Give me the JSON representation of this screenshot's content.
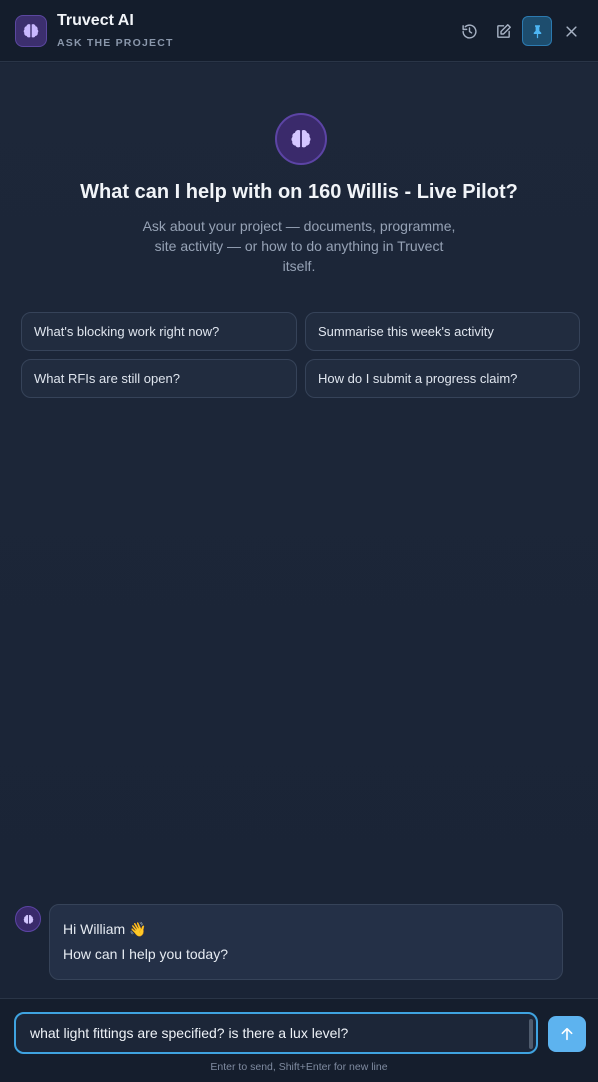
{
  "header": {
    "title": "Truvect AI",
    "subtitle": "ASK THE PROJECT",
    "icons": [
      "brain-icon",
      "history-icon",
      "edit-icon",
      "pin-icon",
      "close-icon"
    ]
  },
  "hero": {
    "title": "What can I help with on 160 Willis - Live Pilot?",
    "description": "Ask about your project — documents, programme, site activity — or how to do anything in Truvect itself."
  },
  "suggestions": [
    "What's blocking work right now?",
    "Summarise this week's activity",
    "What RFIs are still open?",
    "How do I submit a progress claim?"
  ],
  "message": {
    "greeting": "Hi William 👋",
    "text": "How can I help you today?"
  },
  "composer": {
    "value": "what light fittings are specified? is there a lux level?",
    "hint": "Enter to send, Shift+Enter for new line"
  },
  "colors": {
    "accent": "#5db3ef",
    "brand": "#3c2f6e"
  }
}
